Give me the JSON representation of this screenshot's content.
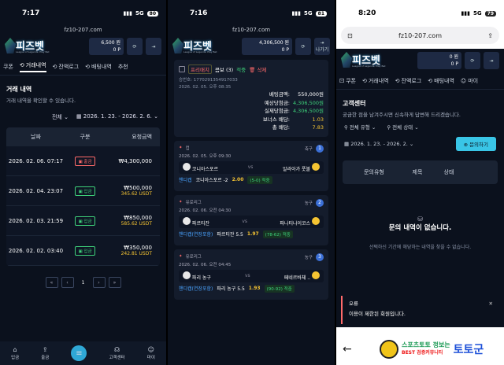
{
  "p1": {
    "time": "7:17",
    "signal": "5G",
    "battery": "80",
    "url": "fz10-207.com",
    "logo": "피즈벳",
    "logo_sub": "League of Legends, Play Bet",
    "balance": "6,500 원",
    "points": "0 P",
    "tabs": [
      "쿠폰",
      "거래내역",
      "잔액로그",
      "배팅내역",
      "추천"
    ],
    "active_tab": "거래내역",
    "section_title": "거래 내역",
    "section_desc": "거래 내역을 확인할 수 있습니다.",
    "filter": "전체",
    "date_range": "2026. 1. 23. - 2026. 2. 6.",
    "cols": [
      "날짜",
      "구분",
      "요청금액"
    ],
    "rows": [
      {
        "date": "2026. 02. 06. 07:17",
        "type": "출금",
        "kind": "out",
        "amount": "₩4,300,000",
        "usdt": ""
      },
      {
        "date": "2026. 02. 04. 23:07",
        "type": "입금",
        "kind": "in",
        "amount": "₩500,000",
        "usdt": "345.62 USDT"
      },
      {
        "date": "2026. 02. 03. 21:59",
        "type": "입금",
        "kind": "in",
        "amount": "₩850,000",
        "usdt": "585.62 USDT"
      },
      {
        "date": "2026. 02. 02. 03:40",
        "type": "입금",
        "kind": "in",
        "amount": "₩350,000",
        "usdt": "242.81 USDT"
      }
    ],
    "pager": [
      "«",
      "‹",
      "1",
      "›",
      "»"
    ],
    "nav": [
      "입금",
      "출금",
      "",
      "고객센터",
      "마이"
    ]
  },
  "p2": {
    "time": "7:16",
    "signal": "5G",
    "battery": "81",
    "url": "fz10-207.com",
    "balance": "4,306,500 원",
    "points": "0 P",
    "exit": "나가기",
    "slip": {
      "badge1": "프리매치",
      "badge2": "콤보 (3)",
      "status": "적중",
      "delete": "삭제",
      "id": "승번호: 1770291354917033",
      "date": "2026. 02. 05. 오후 08:35",
      "rows": [
        {
          "k": "베팅금액:",
          "v": "550,000원"
        },
        {
          "k": "예상당첨금:",
          "v": "4,306,500원"
        },
        {
          "k": "실제당첨금:",
          "v": "4,306,500원"
        },
        {
          "k": "보너스 배당:",
          "v": "1.03"
        },
        {
          "k": "총 배당:",
          "v": "7.83"
        }
      ]
    },
    "bets": [
      {
        "league": "컵",
        "sport": "축구",
        "num": "1",
        "time": "2026. 02. 05. 오후 09:30",
        "home": "코니아스포르",
        "away": "알라아가 풋볼",
        "market": "핸디캡",
        "pick": "코니아스포르 -2",
        "odds": "2.00",
        "result": "(5-0) 적중"
      },
      {
        "league": "유로리그",
        "sport": "농구",
        "num": "2",
        "time": "2026. 02. 06. 오전 04:30",
        "home": "파르티잔",
        "away": "파나티나이코스",
        "market": "핸디캡(연장포함)",
        "pick": "파르티잔 5.5",
        "odds": "1.97",
        "result": "(78-62) 적중"
      },
      {
        "league": "유로리그",
        "sport": "농구",
        "num": "3",
        "time": "2026. 02. 06. 오전 04:45",
        "home": "파리 농구",
        "away": "페네르바체 ..",
        "market": "핸디캡(연장포함)",
        "pick": "파리 농구 5.5",
        "odds": "1.93",
        "result": "(90-92) 적중"
      }
    ]
  },
  "p3": {
    "time": "8:20",
    "signal": "5G",
    "battery": "79",
    "url": "fz10-207.com",
    "balance": "0 원",
    "points": "0 P",
    "tabs": [
      "쿠폰",
      "거래내역",
      "잔액로그",
      "배팅내역",
      "마이"
    ],
    "title": "고객센터",
    "desc": "궁금한 점을 남겨주시면 신속하게 답변해 드리겠습니다.",
    "type_sel": "전체 유형",
    "status_sel": "전체 상태",
    "date": "2026. 1. 23. - 2026. 2.",
    "ask": "문의하기",
    "cols": [
      "문의유형",
      "제목",
      "상태"
    ],
    "empty": "문의 내역이 없습니다.",
    "empty_sub": "선택하신 기간에 해당하는 내역을 찾을 수 없습니다.",
    "toast_title": "오류",
    "toast_msg": "이용이 제한된 회원입니다.",
    "ad_a": "스포츠토토 정보는",
    "ad_b": "BEST 검증커뮤니티",
    "ad_big": "토토군"
  }
}
